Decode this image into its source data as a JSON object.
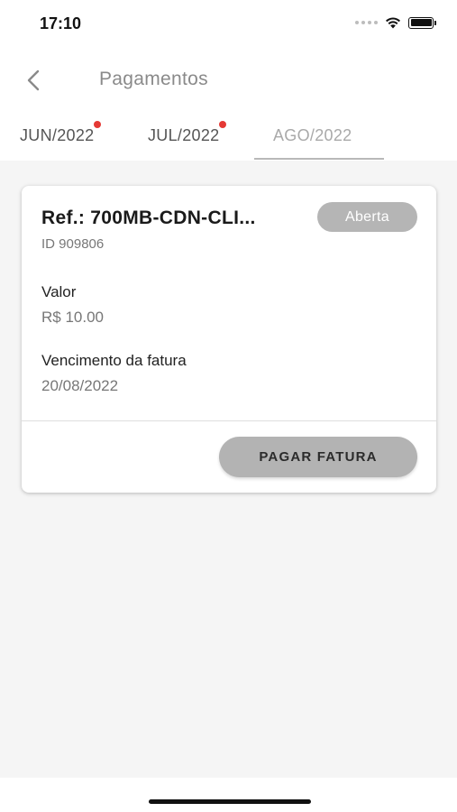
{
  "status_bar": {
    "time": "17:10"
  },
  "header": {
    "title": "Pagamentos"
  },
  "tabs": [
    {
      "label": "JUN/2022",
      "has_badge": true
    },
    {
      "label": "JUL/2022",
      "has_badge": true
    },
    {
      "label": "AGO/2022",
      "active": true
    }
  ],
  "invoice": {
    "ref": "Ref.: 700MB-CDN-CLI...",
    "status": "Aberta",
    "id": "ID 909806",
    "value_label": "Valor",
    "value": "R$ 10.00",
    "due_label": "Vencimento da fatura",
    "due_date": "20/08/2022",
    "pay_label": "PAGAR FATURA"
  },
  "colors": {
    "badge_dot": "#e53935",
    "status_badge_bg": "#b5b5b5",
    "pay_button_bg": "#b3b3b3"
  }
}
